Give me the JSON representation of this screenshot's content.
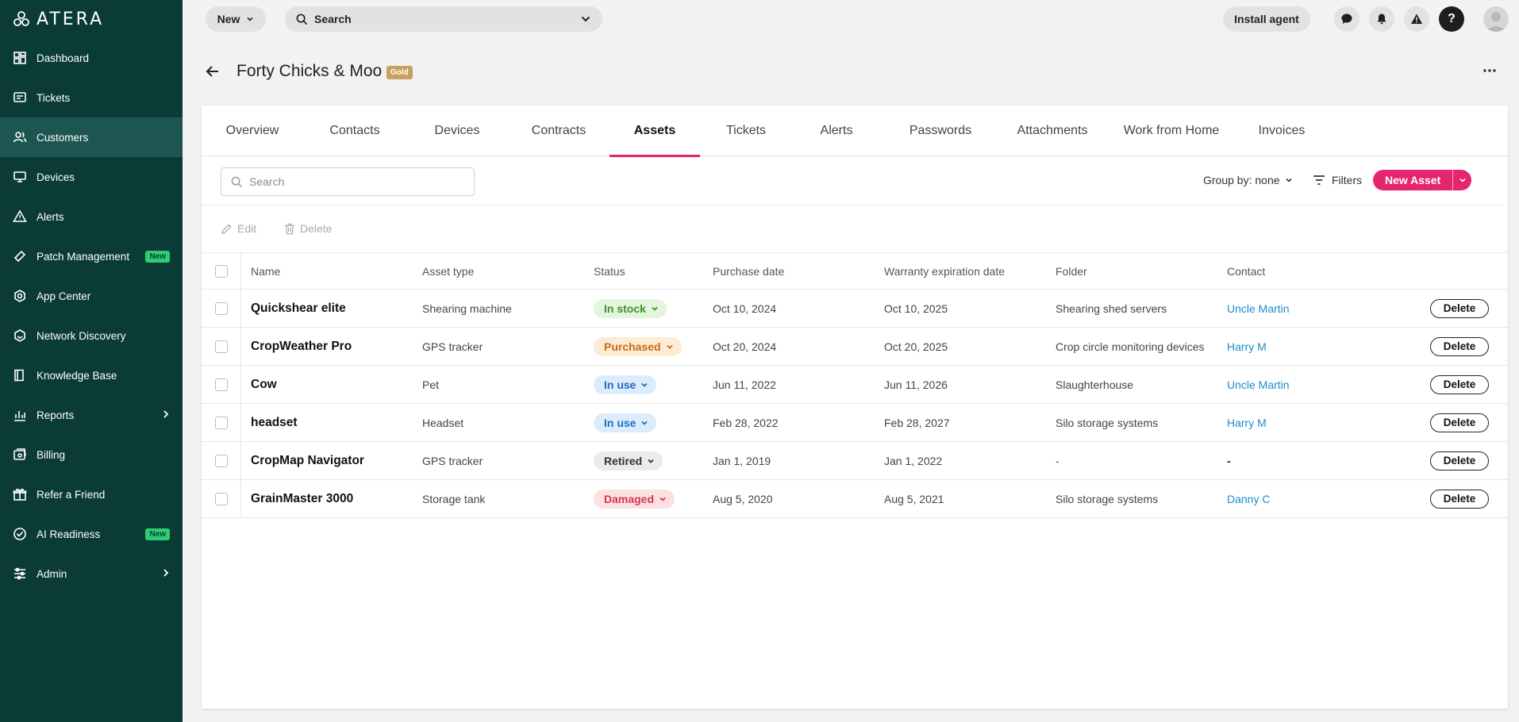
{
  "app": {
    "logo_text": "ATERA"
  },
  "sidebar": {
    "items": [
      {
        "label": "Dashboard",
        "icon": "dashboard-icon",
        "active": false
      },
      {
        "label": "Tickets",
        "icon": "ticket-icon",
        "active": false
      },
      {
        "label": "Customers",
        "icon": "customers-icon",
        "active": true
      },
      {
        "label": "Devices",
        "icon": "devices-icon",
        "active": false
      },
      {
        "label": "Alerts",
        "icon": "alert-icon",
        "active": false
      },
      {
        "label": "Patch Management",
        "icon": "patch-icon",
        "badge": "New",
        "active": false
      },
      {
        "label": "App Center",
        "icon": "app-center-icon",
        "active": false
      },
      {
        "label": "Network Discovery",
        "icon": "network-icon",
        "active": false
      },
      {
        "label": "Knowledge Base",
        "icon": "book-icon",
        "active": false
      },
      {
        "label": "Reports",
        "icon": "reports-icon",
        "chevron": true,
        "active": false
      },
      {
        "label": "Billing",
        "icon": "billing-icon",
        "active": false
      },
      {
        "label": "Refer a Friend",
        "icon": "gift-icon",
        "active": false
      },
      {
        "label": "AI Readiness",
        "icon": "ai-readiness-icon",
        "badge": "New",
        "active": false
      },
      {
        "label": "Admin",
        "icon": "admin-icon",
        "chevron": true,
        "active": false
      }
    ]
  },
  "topbar": {
    "new_label": "New",
    "search_label": "Search",
    "install_label": "Install agent",
    "help_label": "?"
  },
  "page": {
    "title": "Forty Chicks & Moo",
    "tier_badge": "Gold"
  },
  "tabs": [
    {
      "label": "Overview",
      "active": false
    },
    {
      "label": "Contacts",
      "active": false
    },
    {
      "label": "Devices",
      "active": false
    },
    {
      "label": "Contracts",
      "active": false
    },
    {
      "label": "Assets",
      "active": true
    },
    {
      "label": "Tickets",
      "active": false
    },
    {
      "label": "Alerts",
      "active": false
    },
    {
      "label": "Passwords",
      "active": false
    },
    {
      "label": "Attachments",
      "active": false
    },
    {
      "label": "Work from Home",
      "active": false
    },
    {
      "label": "Invoices",
      "active": false
    }
  ],
  "toolbar": {
    "search_placeholder": "Search",
    "group_by_label": "Group by: none",
    "filters_label": "Filters",
    "new_asset_label": "New Asset"
  },
  "actions": {
    "edit_label": "Edit",
    "delete_label": "Delete"
  },
  "colors": {
    "accent": "#e6256f",
    "sidebar": "#0b3b36",
    "link": "#1d8ccc"
  },
  "table": {
    "headers": {
      "name": "Name",
      "type": "Asset type",
      "status": "Status",
      "purchase": "Purchase date",
      "warranty": "Warranty expiration date",
      "folder": "Folder",
      "contact": "Contact"
    },
    "delete_label": "Delete",
    "rows": [
      {
        "name": "Quickshear elite",
        "type": "Shearing machine",
        "status": "In stock",
        "status_bg": "#e3f5dc",
        "status_fg": "#3f8f2a",
        "purchase": "Oct 10, 2024",
        "warranty": "Oct 10, 2025",
        "folder": "Shearing shed servers",
        "contact": "Uncle Martin",
        "contact_link": true
      },
      {
        "name": "CropWeather Pro",
        "type": "GPS tracker",
        "status": "Purchased",
        "status_bg": "#fdebd6",
        "status_fg": "#c86a10",
        "purchase": "Oct 20, 2024",
        "warranty": "Oct 20, 2025",
        "folder": "Crop circle monitoring devices",
        "contact": "Harry M",
        "contact_link": true
      },
      {
        "name": "Cow",
        "type": "Pet",
        "status": "In use",
        "status_bg": "#dcecfb",
        "status_fg": "#1d6fc0",
        "purchase": "Jun 11, 2022",
        "warranty": "Jun 11, 2026",
        "folder": "Slaughterhouse",
        "contact": "Uncle Martin",
        "contact_link": true
      },
      {
        "name": "headset",
        "type": "Headset",
        "status": "In use",
        "status_bg": "#dcecfb",
        "status_fg": "#1d6fc0",
        "purchase": "Feb 28, 2022",
        "warranty": "Feb 28, 2027",
        "folder": "Silo storage systems",
        "contact": "Harry M",
        "contact_link": true
      },
      {
        "name": "CropMap Navigator",
        "type": "GPS tracker",
        "status": "Retired",
        "status_bg": "#ebebeb",
        "status_fg": "#333333",
        "purchase": "Jan 1, 2019",
        "warranty": "Jan 1, 2022",
        "folder": "-",
        "contact": "-",
        "contact_link": false
      },
      {
        "name": "GrainMaster 3000",
        "type": "Storage tank",
        "status": "Damaged",
        "status_bg": "#fde0e2",
        "status_fg": "#d13a4a",
        "purchase": "Aug 5, 2020",
        "warranty": "Aug 5, 2021",
        "folder": "Silo storage systems",
        "contact": "Danny C",
        "contact_link": true
      }
    ]
  }
}
